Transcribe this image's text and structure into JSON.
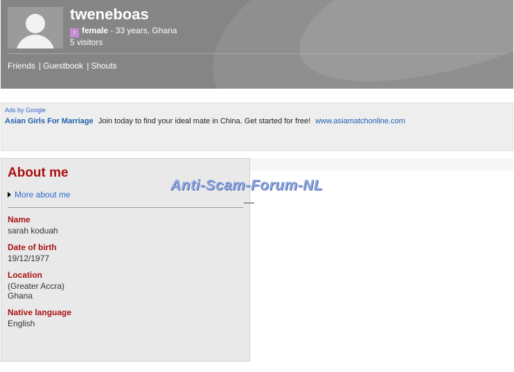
{
  "profile": {
    "username": "tweneboas",
    "gender": "female",
    "age_location": " - 33 years, Ghana",
    "visitors": "5 visitors"
  },
  "nav": {
    "friends": "Friends",
    "guestbook": "Guestbook",
    "shouts": "Shouts",
    "separator": "|"
  },
  "ads": {
    "ads_by": "Ads by Google",
    "title": "Asian Girls For Marriage",
    "text": "Join today to find your ideal mate  in China. Get started for free!",
    "url": "www.asiamatchonline.com"
  },
  "about": {
    "heading": "About me",
    "more_link": "More about me",
    "fields": [
      {
        "label": "Name",
        "value": "sarah koduah"
      },
      {
        "label": "Date of birth",
        "value": "19/12/1977"
      },
      {
        "label": "Location",
        "value_lines": [
          "(Greater Accra)",
          "Ghana"
        ]
      },
      {
        "label": "Native language",
        "value": "English"
      }
    ]
  },
  "watermark": "Anti-Scam-Forum-NL",
  "icons": {
    "avatar": "default-avatar-silhouette",
    "gender": "female-symbol-icon",
    "more_arrow": "triangle-right-icon"
  },
  "colors": {
    "header_bg": "#858585",
    "accent_red": "#aa1111",
    "link_blue": "#2a6acc",
    "panel_bg": "#e9e9e9"
  }
}
